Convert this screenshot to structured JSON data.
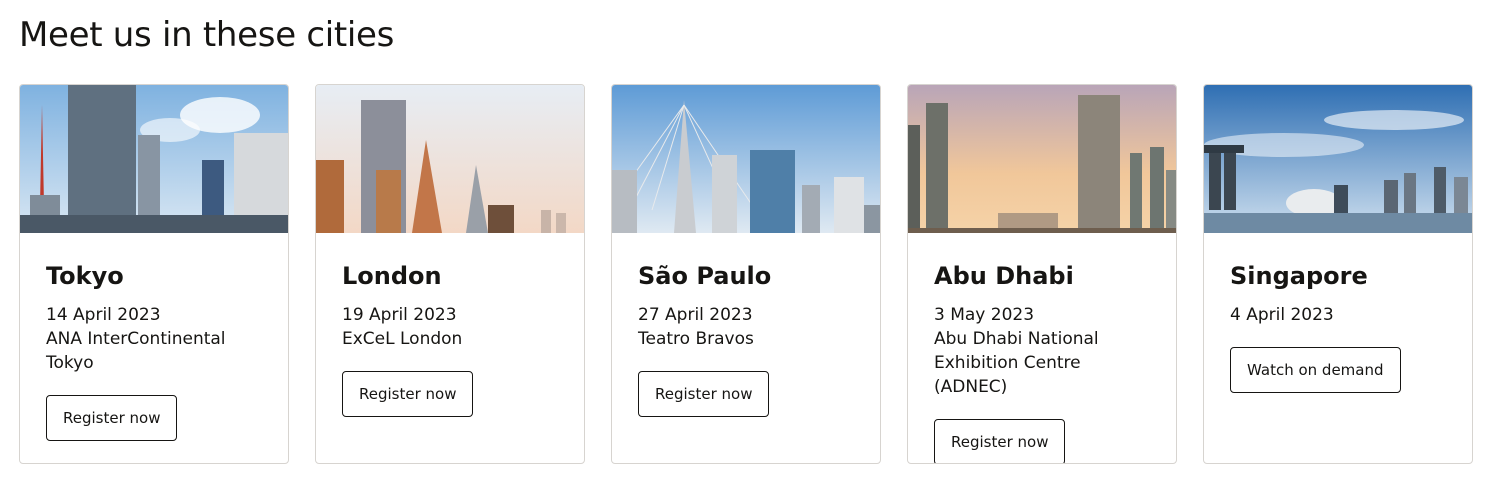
{
  "heading": "Meet us in these cities",
  "cards": [
    {
      "city": "Tokyo",
      "date": "14 April 2023",
      "venue": "ANA InterContinental\nTokyo",
      "button": "Register now"
    },
    {
      "city": "London",
      "date": "19 April 2023",
      "venue": "ExCeL London",
      "button": "Register now"
    },
    {
      "city": "São Paulo",
      "date": "27 April 2023",
      "venue": "Teatro Bravos",
      "button": "Register now"
    },
    {
      "city": "Abu Dhabi",
      "date": "3 May 2023",
      "venue": "Abu Dhabi National\nExhibition Centre (ADNEC)",
      "button": "Register now"
    },
    {
      "city": "Singapore",
      "date": "4 April 2023",
      "venue": "",
      "button": "Watch on demand"
    }
  ]
}
